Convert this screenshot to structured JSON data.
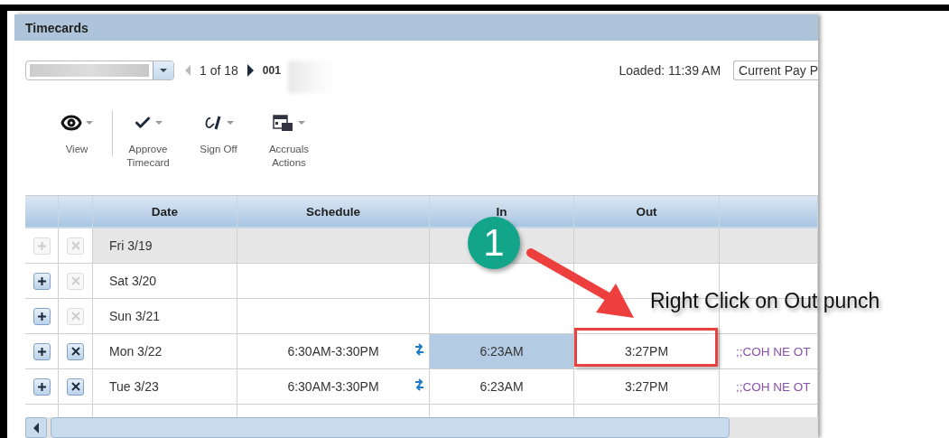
{
  "window": {
    "title": "Timecards"
  },
  "navigation": {
    "position": "1 of 18",
    "employee_id": "001",
    "loaded": "Loaded: 11:39 AM",
    "period": "Current Pay P"
  },
  "toolbar": [
    {
      "kind": "view",
      "label": "View"
    },
    {
      "kind": "approve",
      "label": "Approve Timecard"
    },
    {
      "kind": "signoff",
      "label": "Sign Off"
    },
    {
      "kind": "accruals",
      "label": "Accruals Actions"
    }
  ],
  "table": {
    "columns": [
      "Date",
      "Schedule",
      "In",
      "Out"
    ],
    "rows": [
      {
        "date": "Fri 3/19",
        "disabled": true,
        "delete_enabled": false,
        "in_selected": false
      },
      {
        "date": "Sat 3/20",
        "disabled": false,
        "delete_enabled": false,
        "in_selected": false
      },
      {
        "date": "Sun 3/21",
        "disabled": false,
        "delete_enabled": false,
        "in_selected": false
      },
      {
        "date": "Mon 3/22",
        "schedule": "6:30AM-3:30PM",
        "in": "6:23AM",
        "out": "3:27PM",
        "column_7": ";;COH NE OT",
        "disabled": false,
        "delete_enabled": true,
        "in_selected": true
      },
      {
        "date": "Tue 3/23",
        "schedule": "6:30AM-3:30PM",
        "in": "6:23AM",
        "out": "3:27PM",
        "column_7": ";;COH NE OT",
        "disabled": false,
        "delete_enabled": true,
        "in_selected": false
      }
    ]
  },
  "annotation": {
    "step": "1",
    "text": "Right Click on Out punch"
  }
}
